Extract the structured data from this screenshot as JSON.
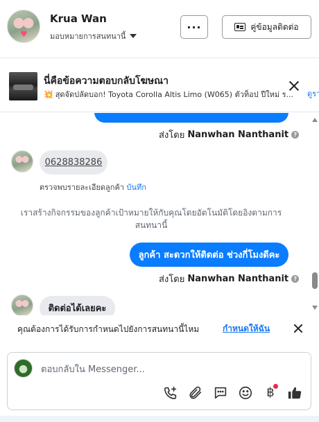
{
  "header": {
    "name": "Krua Wan",
    "assign_label": "มอบหมายการสนทนานี้",
    "more_label": "···",
    "contact_button": "คู่ข้อมูลติดต่อ"
  },
  "ad": {
    "title": "นี่คือข้อความตอบกลับโฆษณา",
    "subtitle": "สุดจัดปลัดบอก! Toyota Corolla Altis Limo (W065) ตัวท็อป ปีใหม่ ร...",
    "link": "ดูรา"
  },
  "chat": {
    "sent_by_prefix": "ส่งโดย",
    "agent_name": "Nanwhan Nanthanit",
    "phone": "0628838286",
    "note_text": "ตรวจพบรายละเอียดลูกค้า",
    "note_link": "บันทึก",
    "system_message": "เราสร้างกิจกรรมของลูกค้าเป้าหมายให้กับคุณโดยอัตโนมัติโดยอิงตามการสนทนานี้",
    "outgoing_message": "ลูกค้า สะดวกให้ติดต่อ ช่วงกี่โมงดีคะ",
    "incoming_last": "ติดต่อได้เลยคะ"
  },
  "prompt": {
    "text": "คุณต้องการได้รับการกำหนดไปยังการสนทนานี้ไหม",
    "link": "กำหนดให้ฉัน"
  },
  "composer": {
    "placeholder": "ตอบกลับใน Messenger...",
    "tools": [
      "add-call-icon",
      "attachment-icon",
      "saved-reply-icon",
      "emoji-icon",
      "baht-icon",
      "like-icon"
    ],
    "baht_symbol": "฿"
  },
  "colors": {
    "accent": "#0a7cff",
    "link": "#1877f2",
    "incoming_bubble": "#e9eaee"
  }
}
